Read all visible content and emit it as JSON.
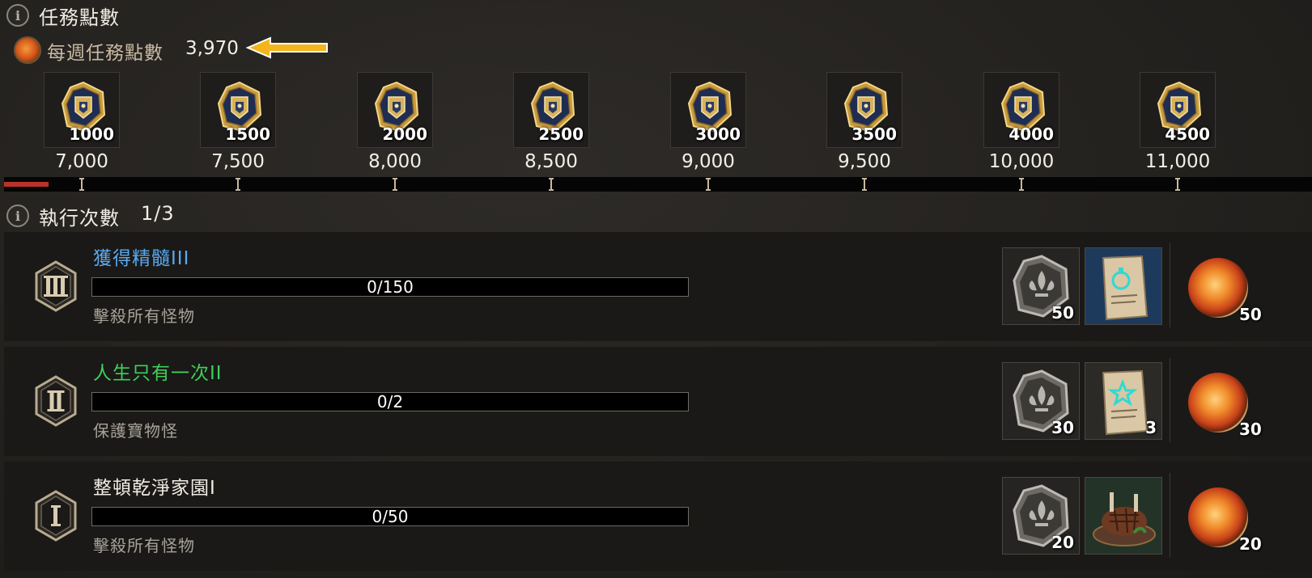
{
  "header": {
    "title": "任務點數",
    "weekly_label": "每週任務點數",
    "weekly_value": "3,970"
  },
  "milestones": [
    {
      "qty": "1000",
      "points": "7,000"
    },
    {
      "qty": "1500",
      "points": "7,500"
    },
    {
      "qty": "2000",
      "points": "8,000"
    },
    {
      "qty": "2500",
      "points": "8,500"
    },
    {
      "qty": "3000",
      "points": "9,000"
    },
    {
      "qty": "3500",
      "points": "9,500"
    },
    {
      "qty": "4000",
      "points": "10,000"
    },
    {
      "qty": "4500",
      "points": "11,000"
    }
  ],
  "executions": {
    "label": "執行次數",
    "value": "1/3"
  },
  "quests": [
    {
      "name": "獲得精髓III",
      "name_color": "#5aa9f0",
      "progress": "0/150",
      "description": "擊殺所有怪物",
      "tier": "III",
      "item1_qty": "50",
      "item2_qty": "",
      "points": "50"
    },
    {
      "name": "人生只有一次II",
      "name_color": "#3fcf5a",
      "progress": "0/2",
      "description": "保護寶物怪",
      "tier": "II",
      "item1_qty": "30",
      "item2_qty": "3",
      "points": "30"
    },
    {
      "name": "整頓乾淨家園I",
      "name_color": "#f0ece4",
      "progress": "0/50",
      "description": "擊殺所有怪物",
      "tier": "I",
      "item1_qty": "20",
      "item2_qty": "",
      "points": "20"
    }
  ],
  "weekly_progress_fraction": 0.0099
}
